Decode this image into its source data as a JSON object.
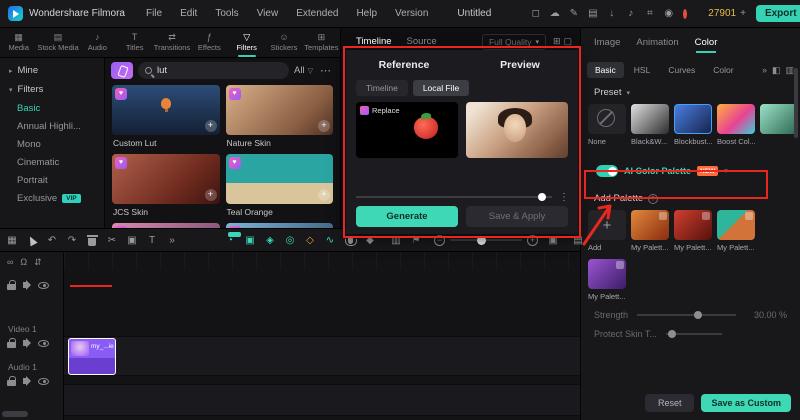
{
  "titlebar": {
    "app_name": "Wondershare Filmora",
    "menus": [
      "File",
      "Edit",
      "Tools",
      "View",
      "Extended",
      "Help",
      "Version"
    ],
    "project_name": "Untitled",
    "coin_count": "27901",
    "export_label": "Export"
  },
  "media_tabs": {
    "items": [
      "Media",
      "Stock Media",
      "Audio",
      "Titles",
      "Transitions",
      "Effects",
      "Filters",
      "Stickers",
      "Templates"
    ],
    "active": "Filters"
  },
  "search": {
    "value": "lut",
    "filter_label": "All"
  },
  "sidebar": {
    "groups": [
      {
        "label": "Mine"
      },
      {
        "label": "Filters"
      }
    ],
    "items": [
      "Basic",
      "Annual Highli...",
      "Mono",
      "Cinematic",
      "Portrait",
      "Exclusive"
    ],
    "active_item": "Basic",
    "vip_badge": "VIP"
  },
  "filter_grid": {
    "items": [
      "Custom Lut",
      "Nature Skin",
      "JCS Skin",
      "Teal Orange"
    ]
  },
  "player": {
    "tabs": [
      "Timeline",
      "Source"
    ],
    "quality": "Full Quality"
  },
  "dialog": {
    "reference_title": "Reference",
    "preview_title": "Preview",
    "tabs": [
      "Timeline",
      "Local File"
    ],
    "active_tab": "Local File",
    "replace_label": "Replace",
    "generate_label": "Generate",
    "save_apply_label": "Save & Apply"
  },
  "color_panel": {
    "tabs": [
      "Image",
      "Animation",
      "Color"
    ],
    "active_tab": "Color",
    "subtabs": [
      "Basic",
      "HSL",
      "Curves",
      "Color"
    ],
    "active_subtab": "Basic",
    "preset_label": "Preset",
    "presets": [
      "None",
      "Black&W...",
      "Blockbust...",
      "Boost Col..."
    ],
    "ai_palette_label": "AI Color Palette",
    "new_badge": "NEW",
    "add_palette_label": "Add Palette",
    "add_label": "Add",
    "palette_items": [
      "My Palett...",
      "My Palett...",
      "My Palett...",
      "My Palett..."
    ],
    "strength_label": "Strength",
    "strength_value": "30.00 %",
    "protect_label": "Protect Skin T...",
    "reset_label": "Reset",
    "save_custom_label": "Save as Custom"
  },
  "timeline": {
    "video_track": "Video 1",
    "audio_track": "Audio 1",
    "clip_name": "my_...ie"
  },
  "colors": {
    "accent": "#35d3b3",
    "purple": "#8a5cf5",
    "annotation_red": "#e8281e",
    "new_badge_bg": "#ff6a3d"
  }
}
